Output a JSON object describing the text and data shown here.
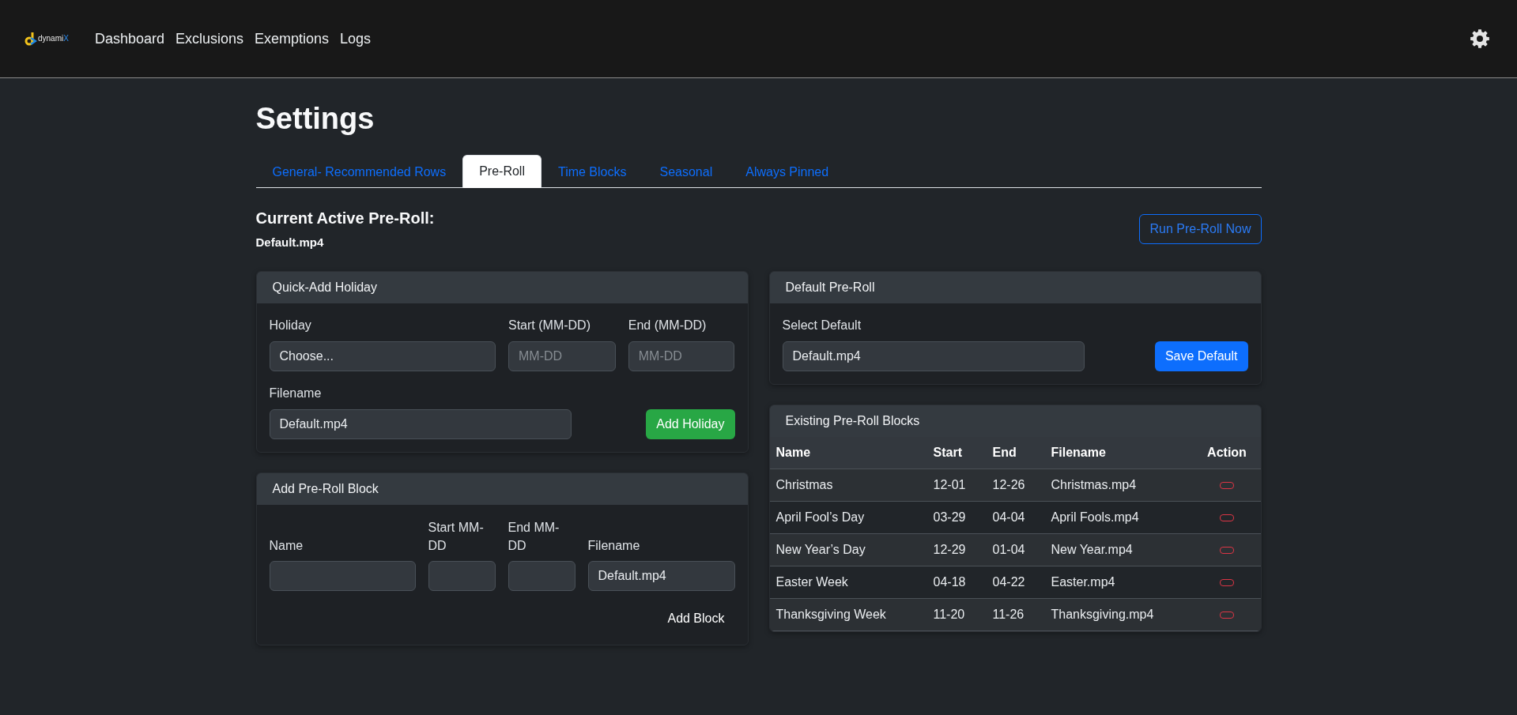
{
  "navbar": {
    "logo": {
      "text": "dynami",
      "accent": "X"
    },
    "links": [
      "Dashboard",
      "Exclusions",
      "Exemptions",
      "Logs"
    ]
  },
  "page": {
    "title": "Settings"
  },
  "tabs": [
    {
      "label": "General- Recommended Rows",
      "selected": false
    },
    {
      "label": "Pre-Roll",
      "selected": true
    },
    {
      "label": "Time Blocks",
      "selected": false
    },
    {
      "label": "Seasonal",
      "selected": false
    },
    {
      "label": "Always Pinned",
      "selected": false
    }
  ],
  "active_preroll": {
    "heading": "Current Active Pre-Roll:",
    "filename": "Default.mp4",
    "button": "Run Pre-Roll Now"
  },
  "quick_add_holiday": {
    "title": "Quick-Add Holiday",
    "fields": [
      {
        "label": "Holiday",
        "value": "Choose..."
      },
      {
        "label": "Start (MM-DD)",
        "placeholder": "MM-DD"
      },
      {
        "label": "End (MM-DD)",
        "placeholder": "MM-DD"
      },
      {
        "label": "Filename",
        "value": "Default.mp4"
      }
    ],
    "button": "Add Holiday"
  },
  "add_block": {
    "title": "Add Pre-Roll Block",
    "fields": [
      {
        "label": "Name"
      },
      {
        "label": "Start MM-DD"
      },
      {
        "label": "End MM-DD"
      },
      {
        "label": "Filename",
        "value": "Default.mp4"
      }
    ],
    "button": "Add Block"
  },
  "default_preroll": {
    "title": "Default Pre-Roll",
    "field": {
      "label": "Select Default",
      "value": "Default.mp4"
    },
    "button": "Save Default"
  },
  "existing_blocks": {
    "title": "Existing Pre-Roll Blocks",
    "columns": [
      "Name",
      "Start",
      "End",
      "Filename",
      "Action"
    ],
    "rows": [
      {
        "name": "Christmas",
        "start": "12-01",
        "end": "12-26",
        "filename": "Christmas.mp4"
      },
      {
        "name": "April Fool’s Day",
        "start": "03-29",
        "end": "04-04",
        "filename": "April Fools.mp4"
      },
      {
        "name": "New Year’s Day",
        "start": "12-29",
        "end": "01-04",
        "filename": "New Year.mp4"
      },
      {
        "name": "Easter Week",
        "start": "04-18",
        "end": "04-22",
        "filename": "Easter.mp4"
      },
      {
        "name": "Thanksgiving Week",
        "start": "11-20",
        "end": "11-26",
        "filename": "Thanksgiving.mp4"
      }
    ]
  }
}
